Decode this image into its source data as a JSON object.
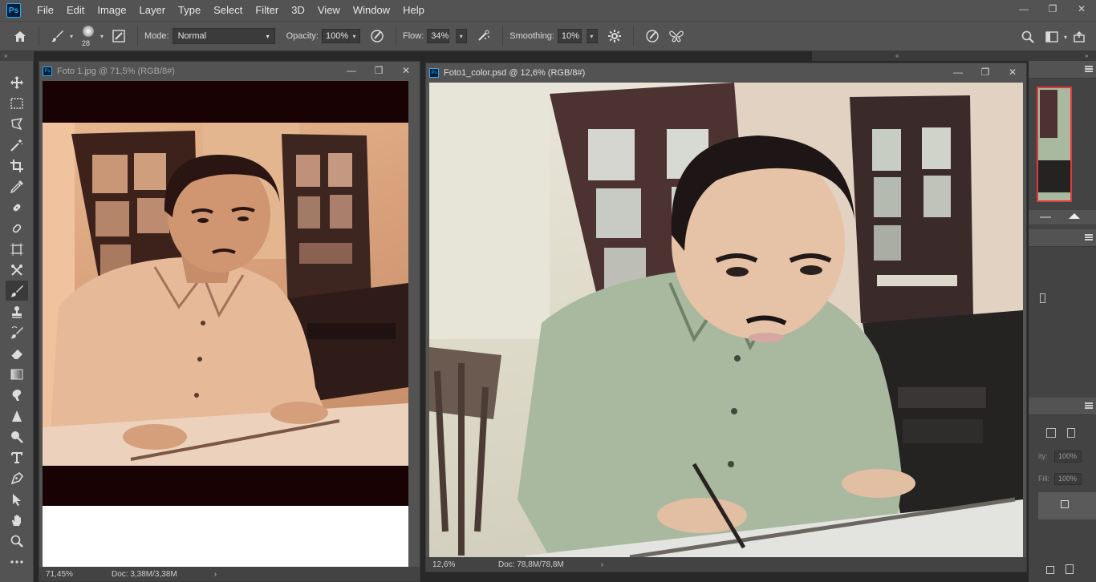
{
  "app": {
    "logo": "Ps"
  },
  "menu": [
    "File",
    "Edit",
    "Image",
    "Layer",
    "Type",
    "Select",
    "Filter",
    "3D",
    "View",
    "Window",
    "Help"
  ],
  "window_controls": {
    "minimize": "—",
    "restore": "❐",
    "close": "✕"
  },
  "options": {
    "brush_size": "28",
    "mode_label": "Mode:",
    "mode_value": "Normal",
    "opacity_label": "Opacity:",
    "opacity_value": "100%",
    "flow_label": "Flow:",
    "flow_value": "34%",
    "smoothing_label": "Smoothing:",
    "smoothing_value": "10%"
  },
  "documents": [
    {
      "title": "Foto 1.jpg @ 71,5% (RGB/8#)",
      "zoom": "71,45%",
      "doc_size": "Doc: 3,38M/3,38M"
    },
    {
      "title": "Foto1_color.psd @ 12,6% (RGB/8#)",
      "zoom": "12,6%",
      "doc_size": "Doc: 78,8M/78,8M"
    }
  ],
  "layers_panel": {
    "opacity_label": "ity:",
    "opacity_value": "100%",
    "fill_label": "Fill:",
    "fill_value": "100%"
  },
  "colors": {
    "ui_bg": "#535353",
    "panel_dark": "#434343",
    "ps_blue": "#31a8ff"
  }
}
